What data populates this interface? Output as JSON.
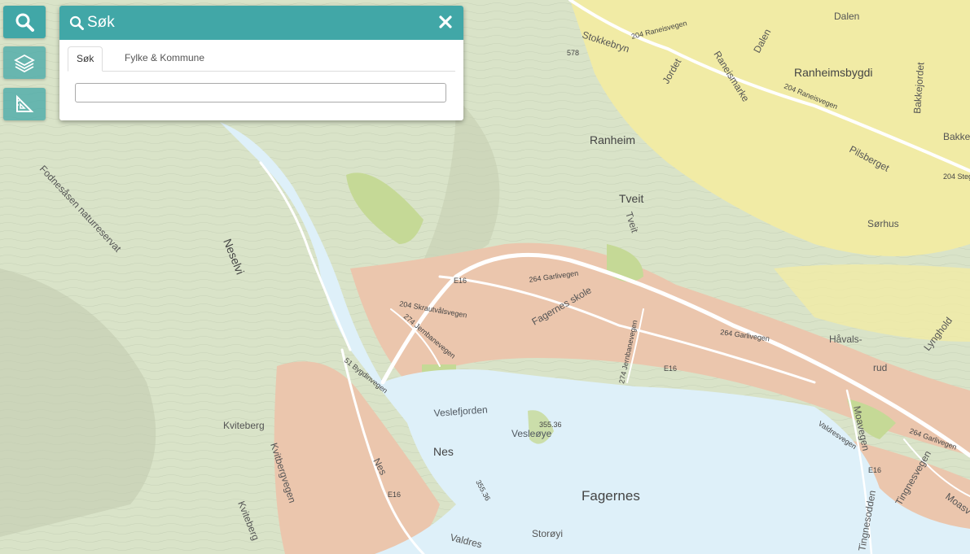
{
  "toolbar": {
    "search_icon": "search-icon",
    "layers_icon": "layers-icon",
    "measure_icon": "ruler-icon"
  },
  "panel": {
    "title": "Søk",
    "header_icon": "search-icon",
    "close_icon": "close-icon",
    "tabs": [
      {
        "label": "Søk",
        "active": true
      },
      {
        "label": "Fylke & Kommune",
        "active": false
      }
    ],
    "input": {
      "value": "",
      "placeholder": ""
    }
  },
  "map": {
    "colors": {
      "water": "#def0f9",
      "terrain": "#d9e3c8",
      "farmland": "#f1eba5",
      "urban": "#ebc6ad",
      "field": "#c5d996",
      "accent": "#41a7a7"
    },
    "labels": {
      "dalen": "Dalen",
      "stokkebryn": "Stokkebryn",
      "raneisvegen_top": "204 Raneisvegen",
      "spot_578": "578",
      "dalen_road": "Dalen",
      "ranheimsbygdi": "Ranheimsbygdi",
      "raneismarke": "Raneismarke",
      "jordet": "Jordet",
      "raneisvegen_mid": "204 Raneisvegen",
      "bakkejordet": "Bakkejordet",
      "bakke": "Bakke",
      "ranheim": "Ranheim",
      "pilsberget": "Pilsberget",
      "steg": "204 Steg",
      "tveit": "Tveit",
      "tveit_road": "Tveit",
      "sorhus": "Sørhus",
      "fodnes": "Fodnesåsen naturreservat",
      "neselvi": "Neselvi",
      "e16_top": "E16",
      "garlivegen1": "264 Garlivegen",
      "fagernes_skole": "Fagernes skole",
      "skrautvalsvegen": "204 Skrautvålsvegen",
      "jernbanevegen1": "274 Jernbanevegen",
      "garlivegen2": "264 Garlivegen",
      "havals": "Håvals-",
      "rud": "rud",
      "lynghold": "Lynghold",
      "jernbanevegen2": "274 Jernbanevegen",
      "e16_mid": "E16",
      "bygdinvegen": "51 Bygdinvegen",
      "veslefjorden": "Veslefjorden",
      "spot_355_36a": "355.36",
      "vesleoye": "Vesleøye",
      "kviteberg": "Kviteberg",
      "kvitbergvegen": "Kvitbergvegen",
      "nes": "Nes",
      "nes_road": "Nes",
      "e16_low": "E16",
      "spot_355_36b": "355.36",
      "fagernes": "Fagernes",
      "moavegen": "Moavegen",
      "valdresvegen": "Valdresvegen",
      "garlivegen3": "264 Garlivegen",
      "e16_right": "E16",
      "tingnesvegen": "Tingnesvegen",
      "tingnesodden": "Tingnesodden",
      "moasv": "Moasv",
      "kvitberg_road": "Kviteberg",
      "valdres": "Valdres",
      "storoyi": "Storøyi"
    }
  }
}
